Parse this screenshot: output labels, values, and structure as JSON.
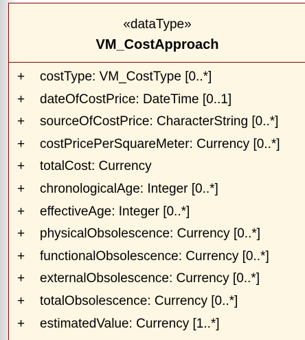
{
  "class": {
    "stereotype": "«dataType»",
    "name": "VM_CostApproach",
    "attributes": [
      {
        "visibility": "+",
        "text": "costType:  VM_CostType [0..*]"
      },
      {
        "visibility": "+",
        "text": "dateOfCostPrice:  DateTime [0..1]"
      },
      {
        "visibility": "+",
        "text": "sourceOfCostPrice:  CharacterString [0..*]"
      },
      {
        "visibility": "+",
        "text": "costPricePerSquareMeter:  Currency [0..*]"
      },
      {
        "visibility": "+",
        "text": "totalCost:  Currency"
      },
      {
        "visibility": "+",
        "text": "chronologicalAge:  Integer [0..*]"
      },
      {
        "visibility": "+",
        "text": "effectiveAge:  Integer [0..*]"
      },
      {
        "visibility": "+",
        "text": "physicalObsolescence:  Currency [0..*]"
      },
      {
        "visibility": "+",
        "text": "functionalObsolescence:  Currency [0..*]"
      },
      {
        "visibility": "+",
        "text": "externalObsolescence:  Currency [0..*]"
      },
      {
        "visibility": "+",
        "text": "totalObsolescence:  Currency [0..*]"
      },
      {
        "visibility": "+",
        "text": "estimatedValue:  Currency [1..*]"
      }
    ]
  },
  "colors": {
    "box_fill": "#fdf7e3",
    "border": "#8b0000",
    "text": "#000000"
  }
}
